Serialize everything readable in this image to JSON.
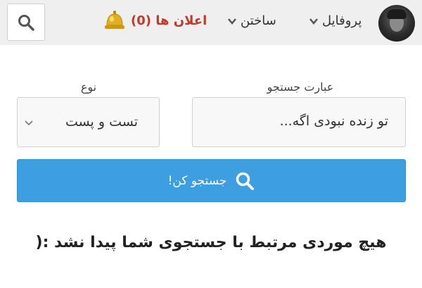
{
  "header": {
    "profile_label": "پروفایل",
    "build_label": "ساختن",
    "notifications_label": "اعلان ها (0)",
    "icons": {
      "search": "search-icon",
      "bell": "bell-icon",
      "chevron": "chevron-down-icon",
      "avatar": "user-avatar"
    }
  },
  "search_form": {
    "query_label": "عبارت جستجو",
    "query_value": "تو زنده نبودی اگه...",
    "type_label": "نوع",
    "type_selected": "تست و پست",
    "submit_label": "جستجو کن!"
  },
  "results": {
    "message": "هیچ موردی مرتبط با جستجوی شما پیدا نشد :("
  },
  "colors": {
    "topbar_bg": "#efefef",
    "primary_button": "#3d9ee0",
    "notification_text": "#c0392b"
  }
}
